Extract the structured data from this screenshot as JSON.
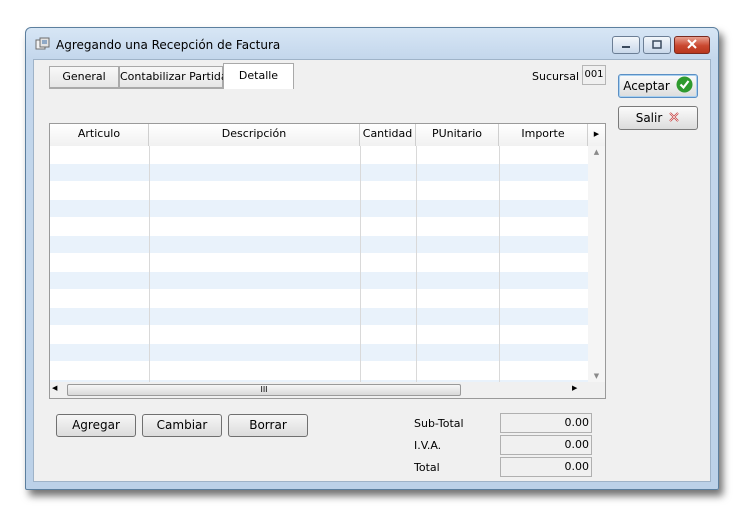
{
  "window": {
    "title": "Agregando una Recepción de Factura"
  },
  "tabs": [
    "General",
    "Contabilizar Partidas",
    "Detalle"
  ],
  "active_tab": "Detalle",
  "sucursal": {
    "label": "Sucursal",
    "value": "001"
  },
  "side_buttons": {
    "aceptar": "Aceptar",
    "salir": "Salir"
  },
  "grid": {
    "columns": [
      "Articulo",
      "Descripción",
      "Cantidad",
      "PUnitario",
      "Importe"
    ],
    "rows": [],
    "hscroll_grip": "III"
  },
  "actions": {
    "agregar": "Agregar",
    "cambiar": "Cambiar",
    "borrar": "Borrar"
  },
  "totals": {
    "subtotal_label": "Sub-Total",
    "subtotal": "0.00",
    "iva_label": "I.V.A.",
    "iva": "0.00",
    "total_label": "Total",
    "total": "0.00"
  },
  "colors": {
    "accept_icon": "#2e9a2e",
    "cancel_icon": "#c43a3a",
    "row_alt": "#e9f2fb"
  },
  "icons": [
    "app-icon",
    "minimize-icon",
    "maximize-icon",
    "close-icon",
    "check-icon",
    "cancel-x-icon"
  ]
}
